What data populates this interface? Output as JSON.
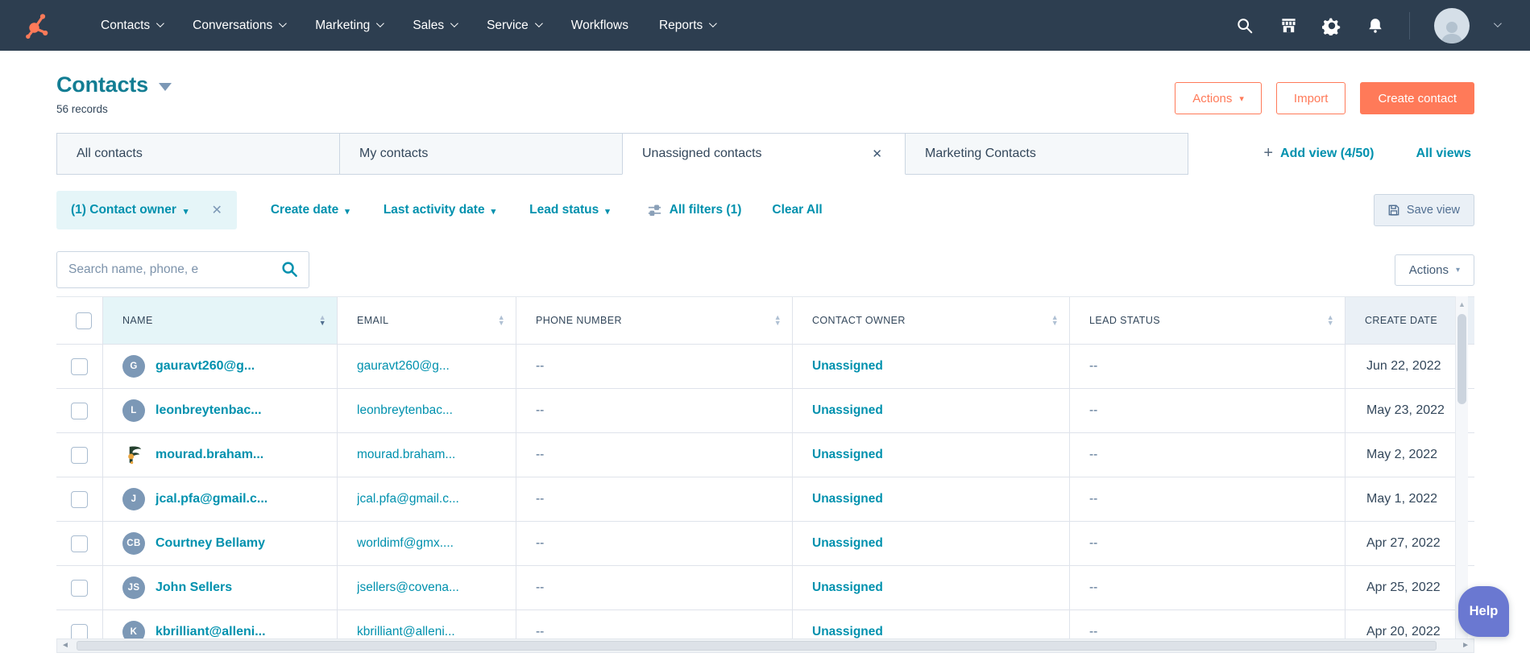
{
  "nav": {
    "items": [
      {
        "label": "Contacts",
        "caret": true
      },
      {
        "label": "Conversations",
        "caret": true
      },
      {
        "label": "Marketing",
        "caret": true
      },
      {
        "label": "Sales",
        "caret": true
      },
      {
        "label": "Service",
        "caret": true
      },
      {
        "label": "Workflows",
        "caret": false
      },
      {
        "label": "Reports",
        "caret": true
      }
    ]
  },
  "header": {
    "title": "Contacts",
    "records": "56 records",
    "actions_label": "Actions",
    "import_label": "Import",
    "create_contact_label": "Create contact"
  },
  "tabs": {
    "items": [
      {
        "label": "All contacts",
        "active": false,
        "closable": false
      },
      {
        "label": "My contacts",
        "active": false,
        "closable": false
      },
      {
        "label": "Unassigned contacts",
        "active": true,
        "closable": true
      },
      {
        "label": "Marketing Contacts",
        "active": false,
        "closable": false
      }
    ],
    "add_view_label": "Add view (4/50)",
    "all_views_label": "All views"
  },
  "filters": {
    "owner_pill_label": "(1) Contact owner",
    "create_date_label": "Create date",
    "last_activity_label": "Last activity date",
    "lead_status_label": "Lead status",
    "all_filters_label": "All filters (1)",
    "clear_all_label": "Clear All",
    "save_view_label": "Save view"
  },
  "toolbar": {
    "search_placeholder": "Search name, phone, e",
    "actions_label": "Actions"
  },
  "table": {
    "columns": [
      {
        "label": "NAME"
      },
      {
        "label": "EMAIL"
      },
      {
        "label": "PHONE NUMBER"
      },
      {
        "label": "CONTACT OWNER"
      },
      {
        "label": "LEAD STATUS"
      },
      {
        "label": "CREATE DATE"
      }
    ],
    "rows": [
      {
        "initials": "G",
        "logo": false,
        "name": "gauravt260@g...",
        "email": "gauravt260@g...",
        "phone": "--",
        "owner": "Unassigned",
        "lead_status": "--",
        "create_date": "Jun 22, 2022"
      },
      {
        "initials": "L",
        "logo": false,
        "name": "leonbreytenbac...",
        "email": "leonbreytenbac...",
        "phone": "--",
        "owner": "Unassigned",
        "lead_status": "--",
        "create_date": "May 23, 2022"
      },
      {
        "initials": "",
        "logo": true,
        "name": "mourad.braham...",
        "email": "mourad.braham...",
        "phone": "--",
        "owner": "Unassigned",
        "lead_status": "--",
        "create_date": "May 2, 2022"
      },
      {
        "initials": "J",
        "logo": false,
        "name": "jcal.pfa@gmail.c...",
        "email": "jcal.pfa@gmail.c...",
        "phone": "--",
        "owner": "Unassigned",
        "lead_status": "--",
        "create_date": "May 1, 2022"
      },
      {
        "initials": "CB",
        "logo": false,
        "name": "Courtney Bellamy",
        "email": "worldimf@gmx....",
        "phone": "--",
        "owner": "Unassigned",
        "lead_status": "--",
        "create_date": "Apr 27, 2022"
      },
      {
        "initials": "JS",
        "logo": false,
        "name": "John Sellers",
        "email": "jsellers@covena...",
        "phone": "--",
        "owner": "Unassigned",
        "lead_status": "--",
        "create_date": "Apr 25, 2022"
      },
      {
        "initials": "K",
        "logo": false,
        "name": "kbrilliant@alleni...",
        "email": "kbrilliant@alleni...",
        "phone": "--",
        "owner": "Unassigned",
        "lead_status": "--",
        "create_date": "Apr 20, 2022"
      }
    ]
  },
  "help_label": "Help",
  "icons": {
    "caret_down": "▾",
    "close": "✕",
    "plus": "+",
    "sort_up": "▲",
    "sort_down": "▼",
    "arrow_up": "▲",
    "arrow_left": "◄",
    "arrow_right": "►"
  },
  "colors": {
    "nav_navy": "#2d3e50",
    "accent_orange": "#ff7a59",
    "link_teal": "#0091ae",
    "title_teal": "#127d93",
    "help_purple": "#6a78d1",
    "avatar_slate": "#7c98b6"
  }
}
